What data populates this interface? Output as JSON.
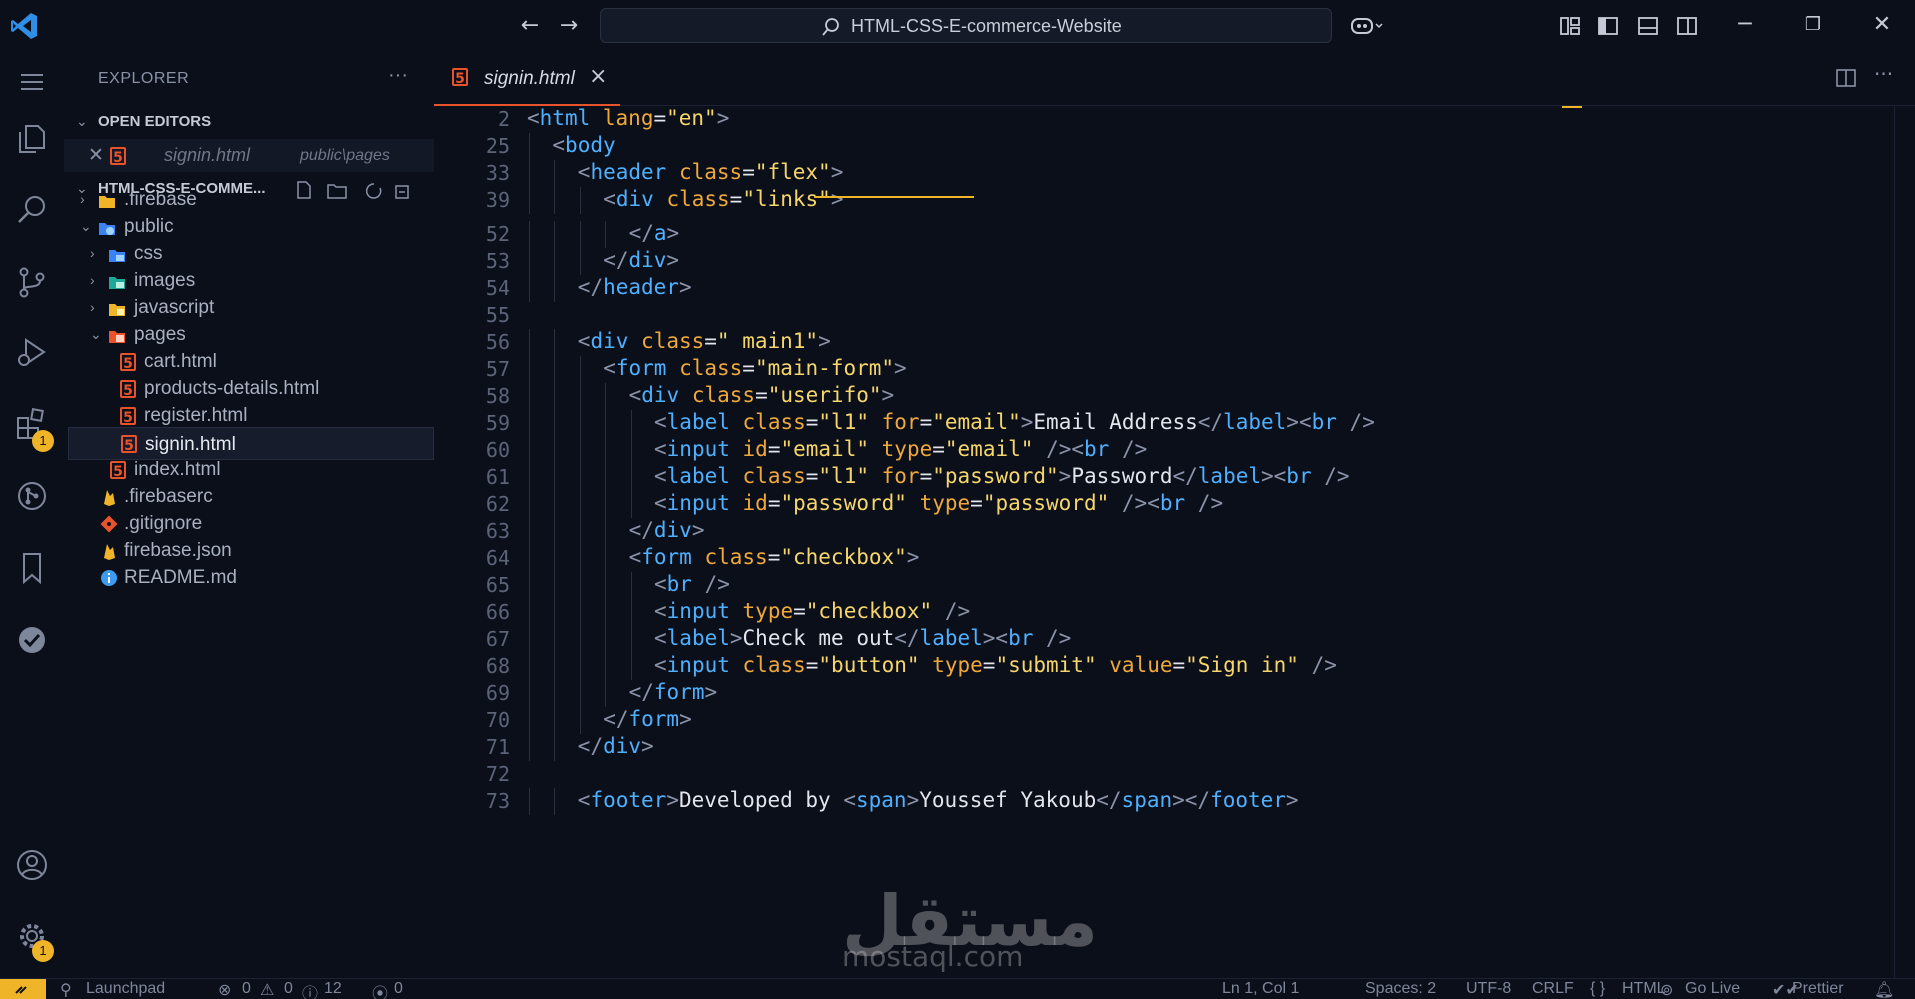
{
  "titlebar": {
    "search_text": "HTML-CSS-E-commerce-Website"
  },
  "sidebar": {
    "title": "EXPLORER",
    "more": "···",
    "open_editors_label": "OPEN EDITORS",
    "open_editor_file": "signin.html",
    "open_editor_path": "public\\pages",
    "project_label": "HTML-CSS-E-COMME...",
    "tree": [
      {
        "label": ".firebase"
      },
      {
        "label": "public"
      },
      {
        "label": "css"
      },
      {
        "label": "images"
      },
      {
        "label": "javascript"
      },
      {
        "label": "pages"
      },
      {
        "label": "cart.html"
      },
      {
        "label": "products-details.html"
      },
      {
        "label": "register.html"
      },
      {
        "label": "signin.html"
      },
      {
        "label": "index.html"
      },
      {
        "label": ".firebaserc"
      },
      {
        "label": ".gitignore"
      },
      {
        "label": "firebase.json"
      },
      {
        "label": "README.md"
      }
    ]
  },
  "badges": {
    "extensions": "1",
    "settings": "1"
  },
  "tab": {
    "label": "signin.html",
    "close": "×"
  },
  "code": {
    "lines": [
      {
        "n": "2"
      },
      {
        "n": "25"
      },
      {
        "n": "33"
      },
      {
        "n": "39"
      },
      {
        "n": "52"
      },
      {
        "n": "53"
      },
      {
        "n": "54"
      },
      {
        "n": "55"
      },
      {
        "n": "56"
      },
      {
        "n": "57"
      },
      {
        "n": "58"
      },
      {
        "n": "59"
      },
      {
        "n": "60"
      },
      {
        "n": "61"
      },
      {
        "n": "62"
      },
      {
        "n": "63"
      },
      {
        "n": "64"
      },
      {
        "n": "65"
      },
      {
        "n": "66"
      },
      {
        "n": "67"
      },
      {
        "n": "68"
      },
      {
        "n": "69"
      },
      {
        "n": "70"
      },
      {
        "n": "71"
      },
      {
        "n": "72"
      },
      {
        "n": "73"
      }
    ],
    "tokens": {
      "l2": [
        "<",
        "html",
        "lang",
        "=",
        "\"en\"",
        ">"
      ],
      "l25": [
        "<",
        "body"
      ],
      "l33": [
        "<",
        "header",
        "class",
        "=",
        "\"flex\"",
        ">"
      ],
      "l39": [
        "<",
        "div",
        "class",
        "=",
        "\"links\"",
        ">"
      ],
      "l52": [
        "</",
        "a",
        ">"
      ],
      "l53": [
        "</",
        "div",
        ">"
      ],
      "l54": [
        "</",
        "header",
        ">"
      ],
      "l56": [
        "<",
        "div",
        "class",
        "=",
        "\" main1\"",
        ">"
      ],
      "l57": [
        "<",
        "form",
        "class",
        "=",
        "\"main-form\"",
        ">"
      ],
      "l58": [
        "<",
        "div",
        "class",
        "=",
        "\"userifo\"",
        ">"
      ],
      "l59": [
        "<",
        "label",
        "class",
        "=",
        "\"l1\"",
        "for",
        "=",
        "\"email\"",
        ">",
        "Email Address",
        "</",
        "label",
        "><",
        "br",
        "/>"
      ],
      "l60": [
        "<",
        "input",
        "id",
        "=",
        "\"email\"",
        "type",
        "=",
        "\"email\"",
        "/><",
        "br",
        "/>"
      ],
      "l61": [
        "<",
        "label",
        "class",
        "=",
        "\"l1\"",
        "for",
        "=",
        "\"password\"",
        ">",
        "Password",
        "</",
        "label",
        "><",
        "br",
        "/>"
      ],
      "l62": [
        "<",
        "input",
        "id",
        "=",
        "\"password\"",
        "type",
        "=",
        "\"password\"",
        "/><",
        "br",
        "/>"
      ],
      "l63": [
        "</",
        "div",
        ">"
      ],
      "l64": [
        "<",
        "form",
        "class",
        "=",
        "\"checkbox\"",
        ">"
      ],
      "l65": [
        "<",
        "br",
        "/>"
      ],
      "l66": [
        "<",
        "input",
        "type",
        "=",
        "\"checkbox\"",
        "/>"
      ],
      "l67": [
        "<",
        "label",
        ">",
        "Check me out",
        "</",
        "label",
        "><",
        "br",
        "/>"
      ],
      "l68": [
        "<",
        "input",
        "class",
        "=",
        "\"button\"",
        "type",
        "=",
        "\"submit\"",
        "value",
        "=",
        "\"Sign in\"",
        "/>"
      ],
      "l69": [
        "</",
        "form",
        ">"
      ],
      "l70": [
        "</",
        "form",
        ">"
      ],
      "l71": [
        "</",
        "div",
        ">"
      ],
      "l73": [
        "<",
        "footer",
        ">",
        "Developed by ",
        "<",
        "span",
        ">",
        "Youssef Yakoub",
        "</",
        "span",
        "></",
        "footer",
        ">"
      ]
    }
  },
  "status": {
    "launchpad": "Launchpad",
    "errors": "0",
    "warnings": "0",
    "info": "12",
    "ports": "0",
    "cursor": "Ln 1, Col 1",
    "spaces": "Spaces: 2",
    "encoding": "UTF-8",
    "eol": "CRLF",
    "language": "HTML",
    "golive": "Go Live",
    "prettier": "Prettier"
  },
  "watermark": {
    "arabic": "مستقل",
    "latin": "mostaql.com"
  },
  "colors": {
    "accent": "#e8532b",
    "tag": "#4fb0ff",
    "attr": "#f0a83a",
    "string": "#f6d66b",
    "badge": "#f0b429"
  }
}
